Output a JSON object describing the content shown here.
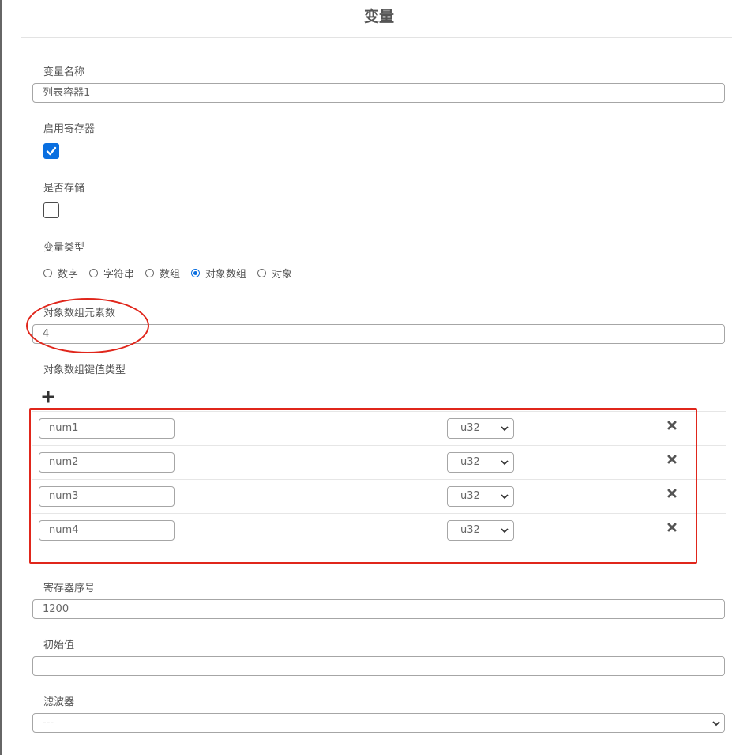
{
  "title": "变量",
  "fields": {
    "variable_name": {
      "label": "变量名称",
      "value": "列表容器1"
    },
    "enable_register": {
      "label": "启用寄存器",
      "checked": true
    },
    "is_storage": {
      "label": "是否存储",
      "checked": false
    },
    "variable_type": {
      "label": "变量类型",
      "options": [
        "数字",
        "字符串",
        "数组",
        "对象数组",
        "对象"
      ],
      "selected": "对象数组"
    },
    "array_element_count": {
      "label": "对象数组元素数",
      "value": "4"
    },
    "key_value_types": {
      "label": "对象数组键值类型",
      "rows": [
        {
          "name": "num1",
          "type": "u32"
        },
        {
          "name": "num2",
          "type": "u32"
        },
        {
          "name": "num3",
          "type": "u32"
        },
        {
          "name": "num4",
          "type": "u32"
        }
      ]
    },
    "register_index": {
      "label": "寄存器序号",
      "value": "1200"
    },
    "initial_value": {
      "label": "初始值",
      "value": ""
    },
    "filter": {
      "label": "滤波器",
      "value": "---"
    }
  },
  "icons": {
    "add": "plus-icon",
    "delete": "close-x-icon",
    "dropdown": "chevron-down-icon",
    "check": "checkmark-icon"
  },
  "colors": {
    "accent": "#0a6fe0",
    "annotation": "#e0261b",
    "text": "#555555",
    "border": "#a6a6a6"
  }
}
